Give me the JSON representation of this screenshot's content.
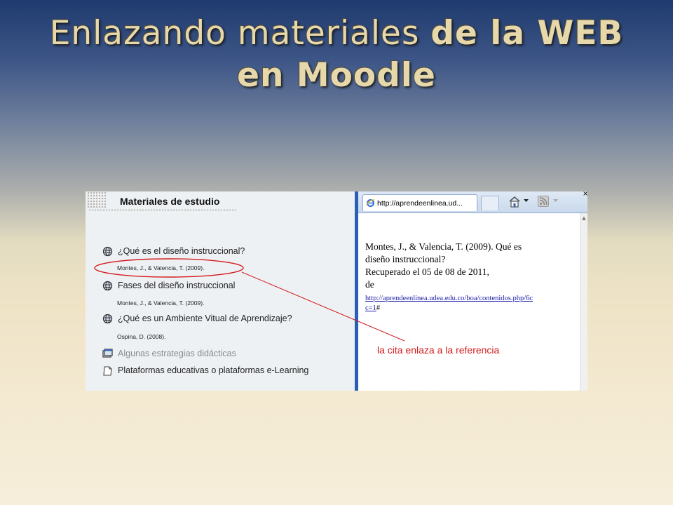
{
  "slide": {
    "title_part1": "Enlazando materiales",
    "title_part2": "de la WEB",
    "title_line2": "en Moodle"
  },
  "moodle": {
    "section_title": "Materiales de estudio",
    "items": [
      {
        "label": "¿Qué es el diseño instruccional?",
        "icon": "web-link-icon",
        "citation": "Montes, J., & Valencia, T. (2009)."
      },
      {
        "label": "Fases del diseño instruccional",
        "icon": "web-link-icon",
        "citation": "Montes, J., & Valencia, T. (2009)."
      },
      {
        "label": "¿Qué es un Ambiente Vitual de Aprendizaje?",
        "icon": "web-link-icon",
        "citation": "Ospina, D. (2008)."
      },
      {
        "label": "Algunas estrategias didácticas",
        "icon": "folder-window-icon",
        "dimmed": true
      },
      {
        "label": "Plataformas educativas o plataformas e-Learning",
        "icon": "page-icon"
      }
    ]
  },
  "browser": {
    "tab_title": "http://aprendeenlinea.ud...",
    "reference": {
      "line1": "Montes, J., & Valencia, T. (2009). Qué es",
      "line2": "diseño instruccional?",
      "line3": "Recuperado el 05 de 08 de 2011,",
      "line4": "de",
      "url_line1": "http://aprendeenlinea.udea.edu.co/boa/contenidos.php/6c",
      "url_line2": "c=1",
      "url_suffix": "#"
    },
    "close_glyph": "×"
  },
  "annotation": {
    "text": "la cita enlaza a la referencia",
    "color": "#d41d1d"
  }
}
